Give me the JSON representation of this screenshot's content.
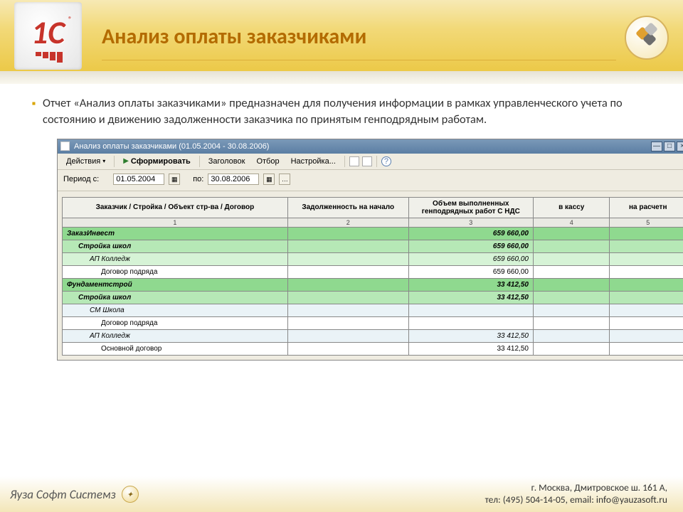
{
  "slide": {
    "title": "Анализ оплаты заказчиками",
    "bullet": "Отчет «Анализ оплаты заказчиками» предназначен для получения информации в рамках управленческого учета по состоянию и движению задолженности заказчика по принятым генподрядным работам."
  },
  "window": {
    "title": "Анализ оплаты заказчиками (01.05.2004 - 30.08.2006)",
    "toolbar": {
      "actions": "Действия",
      "form": "Сформировать",
      "header": "Заголовок",
      "filter": "Отбор",
      "settings": "Настройка..."
    },
    "period": {
      "label_from": "Период с:",
      "date_from": "01.05.2004",
      "label_to": "по:",
      "date_to": "30.08.2006"
    },
    "columns": {
      "c1": "Заказчик / Стройка / Объект стр-ва / Договор",
      "c2": "Задолженность на начало",
      "c3": "Объем выполненных генподрядных работ С НДС",
      "c4": "в кассу",
      "c5": "на расчетн",
      "n1": "1",
      "n2": "2",
      "n3": "3",
      "n4": "4",
      "n5": "5"
    },
    "rows": [
      {
        "lvl": 0,
        "label": "ЗаказИнвест",
        "val": "659 660,00"
      },
      {
        "lvl": 1,
        "label": "Стройка школ",
        "val": "659 660,00"
      },
      {
        "lvl": 2,
        "label": "АП Колледж",
        "val": "659 660,00"
      },
      {
        "lvl": 3,
        "label": "Договор подряда",
        "val": "659 660,00"
      },
      {
        "lvl": 0,
        "label": "Фундаментстрой",
        "val": "33 412,50"
      },
      {
        "lvl": 1,
        "label": "Стройка школ",
        "val": "33 412,50"
      },
      {
        "lvl": 2,
        "label": "СМ Школа",
        "val": "",
        "alt": true
      },
      {
        "lvl": 3,
        "label": "Договор подряда",
        "val": ""
      },
      {
        "lvl": 2,
        "label": "АП Колледж",
        "val": "33 412,50",
        "alt": true
      },
      {
        "lvl": 3,
        "label": "Основной договор",
        "val": "33 412,50"
      }
    ]
  },
  "footer": {
    "brand": "Яуза Софт Системз",
    "line1": "г. Москва, Дмитровское ш. 161 А,",
    "line2": "тел: (495) 504-14-05, email: info@yauzasoft.ru"
  }
}
